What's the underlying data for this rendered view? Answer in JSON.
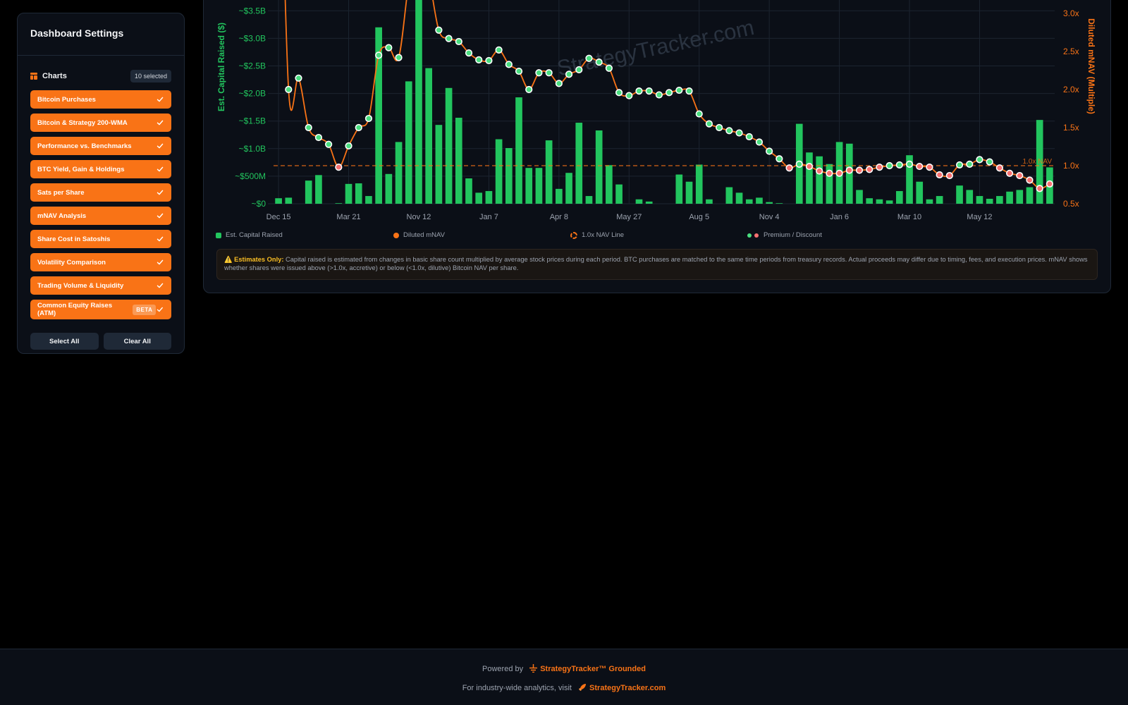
{
  "sidebar": {
    "title": "Dashboard Settings",
    "section_label": "Charts",
    "selected_count": "10 selected",
    "items": [
      {
        "label": "Bitcoin Purchases",
        "checked": true
      },
      {
        "label": "Bitcoin & Strategy 200-WMA",
        "checked": true
      },
      {
        "label": "Performance vs. Benchmarks",
        "checked": true
      },
      {
        "label": "BTC Yield, Gain & Holdings",
        "checked": true
      },
      {
        "label": "Sats per Share",
        "checked": true
      },
      {
        "label": "mNAV Analysis",
        "checked": true
      },
      {
        "label": "Share Cost in Satoshis",
        "checked": true
      },
      {
        "label": "Volatility Comparison",
        "checked": true
      },
      {
        "label": "Trading Volume & Liquidity",
        "checked": true
      },
      {
        "label": "Common Equity Raises (ATM)",
        "checked": true,
        "badge": "BETA"
      }
    ],
    "select_all_label": "Select All",
    "clear_all_label": "Clear All",
    "accent_color": "#f97316"
  },
  "chart_data": {
    "type": "bar",
    "watermark": "StrategyTracker.com",
    "ylabel_left": "Est. Capital Raised ($)",
    "ylabel_right": "Diluted mNAV (Multiple)",
    "left_ticks": [
      "~$0",
      "~$500M",
      "~$1.0B",
      "~$1.5B",
      "~$2.0B",
      "~$2.5B",
      "~$3.0B",
      "~$3.5B"
    ],
    "right_ticks": [
      "0.5x",
      "1.0x",
      "1.5x",
      "2.0x",
      "2.5x",
      "3.0x"
    ],
    "x_tick_labels": [
      "Dec 15",
      "Mar 21",
      "Nov 12",
      "Jan 7",
      "Apr 8",
      "May 27",
      "Aug 5",
      "Nov 4",
      "Jan 6",
      "Mar 10",
      "May 12"
    ],
    "x_tick_index": [
      0,
      7,
      14,
      21,
      28,
      35,
      42,
      49,
      56,
      63,
      70
    ],
    "ylim_left": [
      0,
      3500000000
    ],
    "ylim_right": [
      0.5,
      3.0
    ],
    "nav_line_label": "1.0x NAV",
    "nav_line_value": 1.0,
    "grid": true,
    "bar_color": "#22c55e",
    "line_color": "#f97316",
    "premium_color": "#4ade80",
    "discount_color": "#f87171",
    "legend_position": "bottom",
    "series": [
      {
        "name": "Est. Capital Raised",
        "values": [
          100000000,
          110000000,
          0,
          420000000,
          520000000,
          0,
          10000000,
          360000000,
          370000000,
          140000000,
          3200000000,
          540000000,
          1120000000,
          2220000000,
          3700000000,
          2460000000,
          1430000000,
          2100000000,
          1560000000,
          460000000,
          200000000,
          230000000,
          1170000000,
          1010000000,
          1930000000,
          650000000,
          650000000,
          1150000000,
          270000000,
          560000000,
          1470000000,
          140000000,
          1330000000,
          700000000,
          350000000,
          0,
          80000000,
          40000000,
          0,
          0,
          530000000,
          400000000,
          710000000,
          80000000,
          0,
          300000000,
          200000000,
          80000000,
          110000000,
          30000000,
          10000000,
          0,
          1450000000,
          930000000,
          860000000,
          720000000,
          1120000000,
          1090000000,
          250000000,
          100000000,
          80000000,
          60000000,
          230000000,
          880000000,
          400000000,
          80000000,
          140000000,
          0,
          330000000,
          250000000,
          140000000,
          90000000,
          140000000,
          220000000,
          250000000,
          300000000,
          1520000000,
          660000000
        ]
      },
      {
        "name": "Diluted mNAV",
        "values": [
          6.5,
          2.0,
          2.15,
          1.5,
          1.37,
          1.28,
          0.98,
          1.26,
          1.5,
          1.62,
          2.45,
          2.55,
          2.42,
          3.4,
          4.1,
          3.5,
          2.78,
          2.67,
          2.63,
          2.48,
          2.39,
          2.38,
          2.52,
          2.33,
          2.24,
          2.0,
          2.22,
          2.22,
          2.08,
          2.2,
          2.26,
          2.41,
          2.36,
          2.28,
          1.96,
          1.92,
          1.98,
          1.98,
          1.93,
          1.96,
          1.99,
          1.98,
          1.68,
          1.55,
          1.5,
          1.46,
          1.43,
          1.38,
          1.31,
          1.19,
          1.09,
          0.97,
          1.02,
          0.99,
          0.93,
          0.9,
          0.9,
          0.94,
          0.94,
          0.95,
          0.98,
          1.0,
          1.01,
          1.02,
          0.99,
          0.98,
          0.88,
          0.87,
          1.01,
          1.02,
          1.08,
          1.05,
          0.97,
          0.9,
          0.87,
          0.81,
          0.7,
          0.76
        ]
      }
    ]
  },
  "legend": {
    "capital": "Est. Capital Raised",
    "mnav": "Diluted mNAV",
    "nav_line": "1.0x NAV Line",
    "premium": "Premium / Discount"
  },
  "notice": {
    "title": "⚠️ Estimates Only:",
    "body": "Capital raised is estimated from changes in basic share count multiplied by average stock prices during each period. BTC purchases are matched to the same time periods from treasury records. Actual proceeds may differ due to timing, fees, and execution prices. mNAV shows whether shares were issued above (>1.0x, accretive) or below (<1.0x, dilutive) Bitcoin NAV per share."
  },
  "footer": {
    "powered_by": "Powered by",
    "brand": "StrategyTracker™ Grounded",
    "visit_text": "For industry-wide analytics, visit",
    "visit_link": "StrategyTracker.com"
  }
}
